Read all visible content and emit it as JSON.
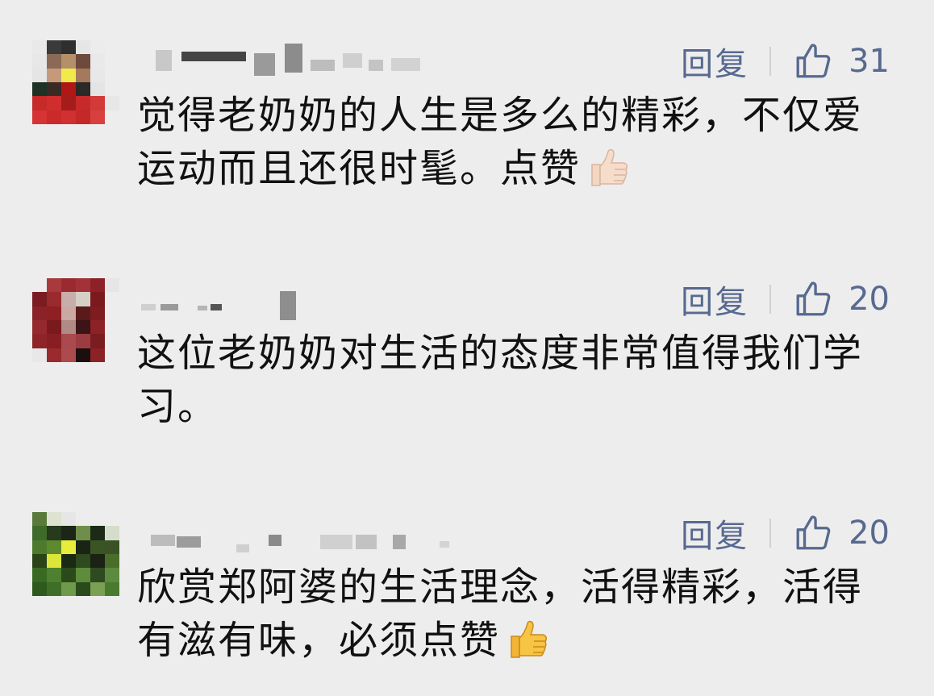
{
  "colors": {
    "background": "#ededed",
    "link_blue": "#57698f",
    "text": "#111111"
  },
  "comments": [
    {
      "reply_label": "回复",
      "like_count": "31",
      "text": "觉得老奶奶的人生是多么的精彩，不仅爱运动而且还很时髦。点赞",
      "emoji": "thumbs-up-light-skin",
      "avatar": "pixelated"
    },
    {
      "reply_label": "回复",
      "like_count": "20",
      "text": "这位老奶奶对生活的态度非常值得我们学习。",
      "emoji": "",
      "avatar": "pixelated"
    },
    {
      "reply_label": "回复",
      "like_count": "20",
      "text": "欣赏郑阿婆的生活理念，活得精彩，活得有滋有味，必须点赞",
      "emoji": "thumbs-up-yellow",
      "avatar": "pixelated"
    }
  ]
}
